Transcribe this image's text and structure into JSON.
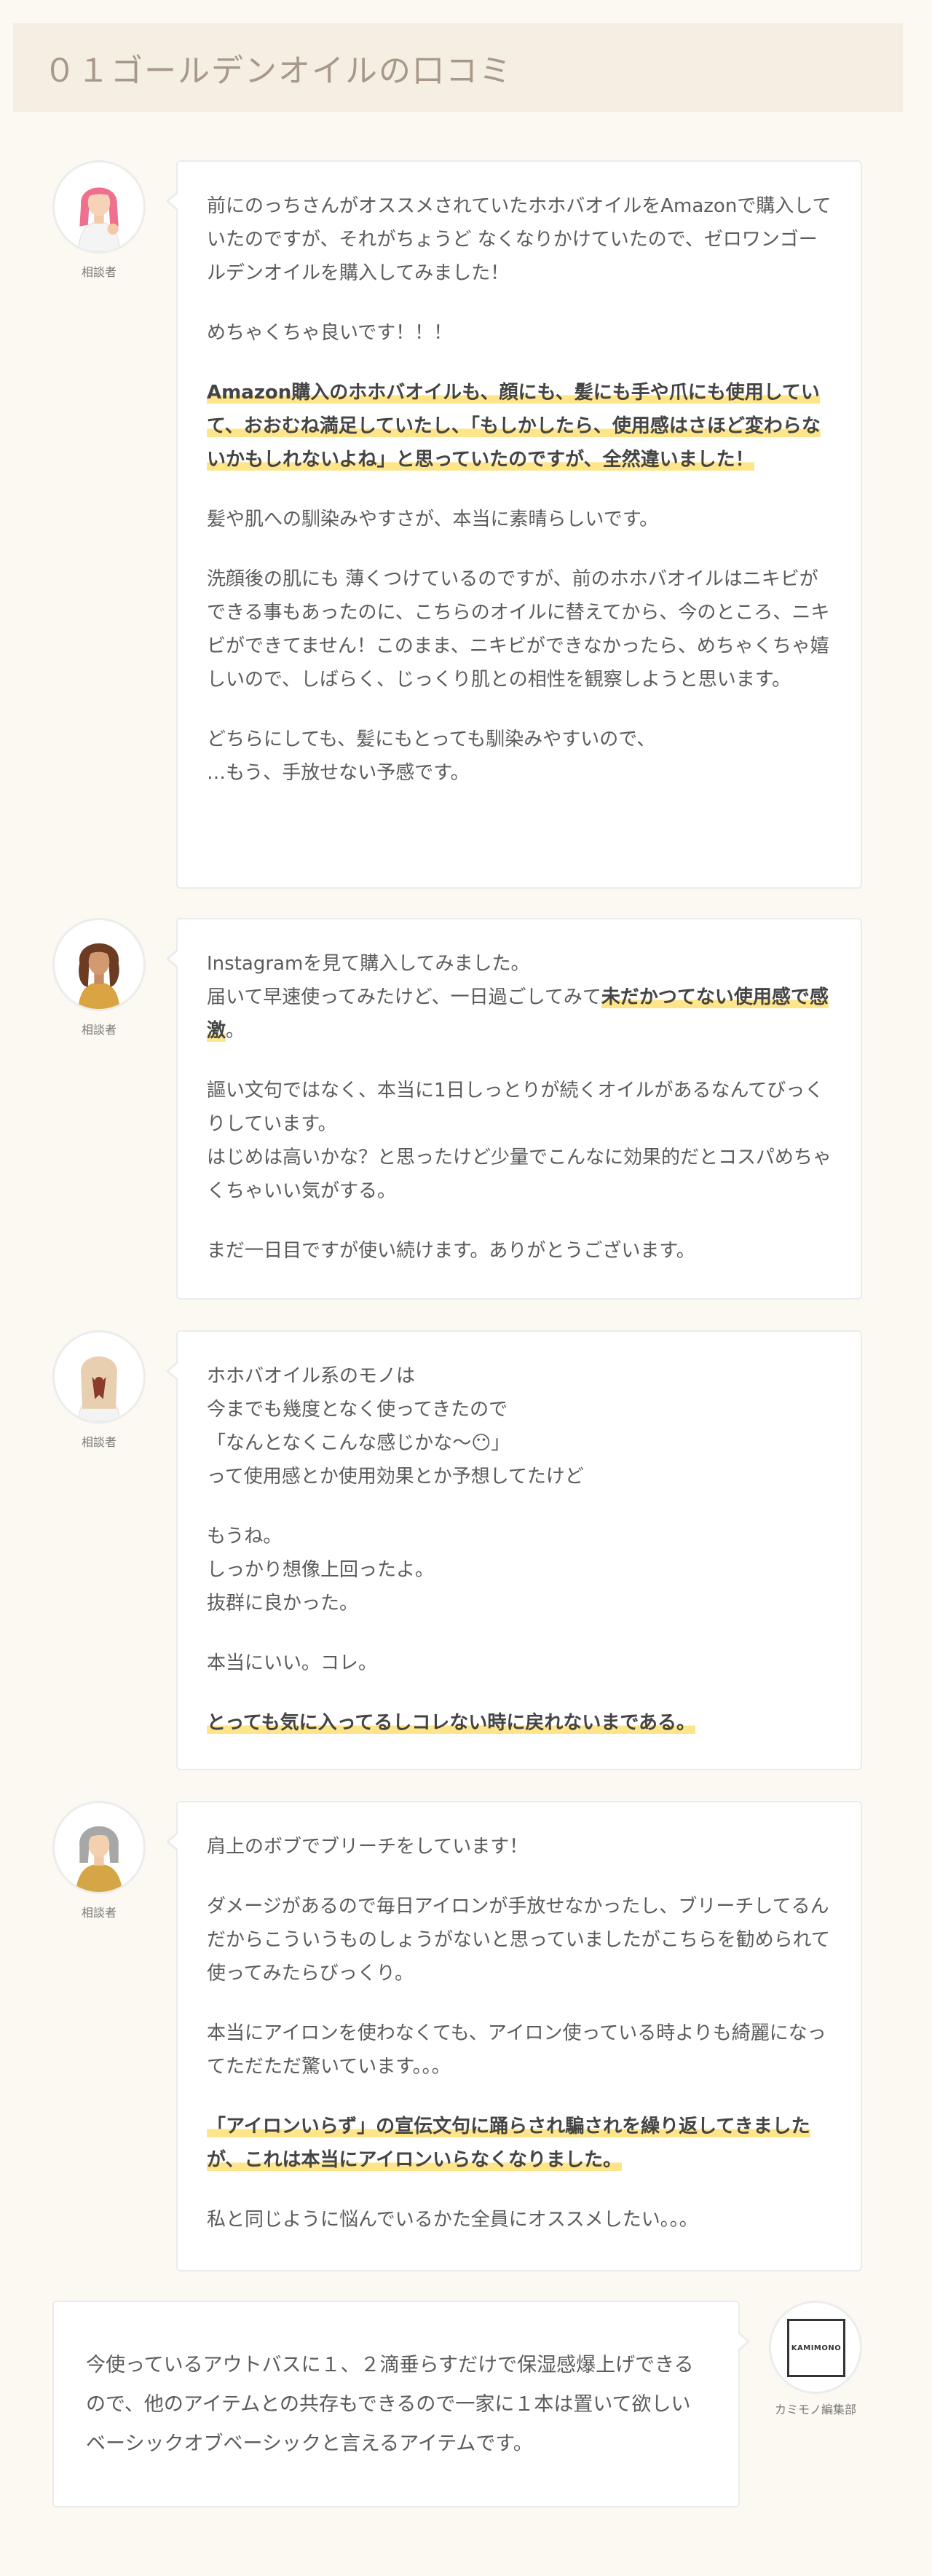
{
  "section": {
    "title": "０１ゴールデンオイルの口コミ"
  },
  "reviews": [
    {
      "role": "相談者",
      "avatar_icon": "woman-pink-hair-avatar-icon",
      "paragraphs": [
        {
          "text": "前にのっちさんがオススメされていたホホバオイルをAmazonで購入していたのですが、それがちょうど なくなりかけていたので、ゼロワンゴールデンオイルを購入してみました！"
        },
        {
          "text": "めちゃくちゃ良いです！！！"
        },
        {
          "mark": "Amazon購入のホホバオイルも、顔にも、髪にも手や爪にも使用していて、おおむね満足していたし、「もしかしたら、使用感はさほど変わらないかもしれないよね」と思っていたのですが、全然違いました！"
        },
        {
          "text": "髪や肌への馴染みやすさが、本当に素晴らしいです。"
        },
        {
          "text": "洗顔後の肌にも 薄くつけているのですが、前のホホバオイルはニキビができる事もあったのに、こちらのオイルに替えてから、今のところ、ニキビができてません！このまま、ニキビができなかったら、めちゃくちゃ嬉しいので、しばらく、じっくり肌との相性を観察しようと思います。"
        },
        {
          "text": "どちらにしても、髪にもとっても馴染みやすいので、\n…もう、手放せない予感です。"
        }
      ]
    },
    {
      "role": "相談者",
      "avatar_icon": "woman-curly-hair-avatar-icon",
      "paragraphs": [
        {
          "text": "Instagramを見て購入してみました。\n届いて早速使ってみたけど、一日過ごしてみて",
          "mark": "未だかつてない使用感で感激",
          "after": "。"
        },
        {
          "text": "謳い文句ではなく、本当に1日しっとりが続くオイルがあるなんてびっくりしています。\nはじめは高いかな？と思ったけど少量でこんなに効果的だとコスパめちゃくちゃいい気がする。"
        },
        {
          "text": "まだ一日目ですが使い続けます。ありがとうございます。"
        }
      ]
    },
    {
      "role": "相談者",
      "avatar_icon": "woman-ribbon-hair-avatar-icon",
      "paragraphs": [
        {
          "text": "ホホバオイル系のモノは\n今までも幾度となく使ってきたので\n「なんとなくこんな感じかな〜😶」\nって使用感とか使用効果とか予想してたけど"
        },
        {
          "text": "もうね。\nしっかり想像上回ったよ。\n抜群に良かった。"
        },
        {
          "text": "本当にいい。コレ。"
        },
        {
          "mark": "とっても気に入ってるしコレない時に戻れないまである。"
        }
      ]
    },
    {
      "role": "相談者",
      "avatar_icon": "woman-gray-bob-avatar-icon",
      "paragraphs": [
        {
          "text": "肩上のボブでブリーチをしています！"
        },
        {
          "text": "ダメージがあるので毎日アイロンが手放せなかったし、ブリーチしてるんだからこういうものしょうがないと思っていましたがこちらを勧められて使ってみたらびっくり。"
        },
        {
          "text": "本当にアイロンを使わなくても、アイロン使っている時よりも綺麗になってただただ驚いています。。。"
        },
        {
          "mark": "「アイロンいらず」の宣伝文句に踊らされ騙されを繰り返してきましたが、これは本当にアイロンいらなくなりました。"
        },
        {
          "text": "私と同じように悩んでいるかた全員にオススメしたい。。。"
        }
      ]
    }
  ],
  "editor": {
    "text": "今使っているアウトバスに１、２滴垂らすだけで保湿感爆上げできるので、他のアイテムとの共存もできるので一家に１本は置いて欲しいベーシックオブベーシックと言えるアイテムです。",
    "name": "カミモノ編集部",
    "logo_text": "KAMIMONO"
  },
  "colors": {
    "highlight": "#ffe58a",
    "header_bg": "#f4eee3",
    "page_bg": "#fcf8f2"
  }
}
